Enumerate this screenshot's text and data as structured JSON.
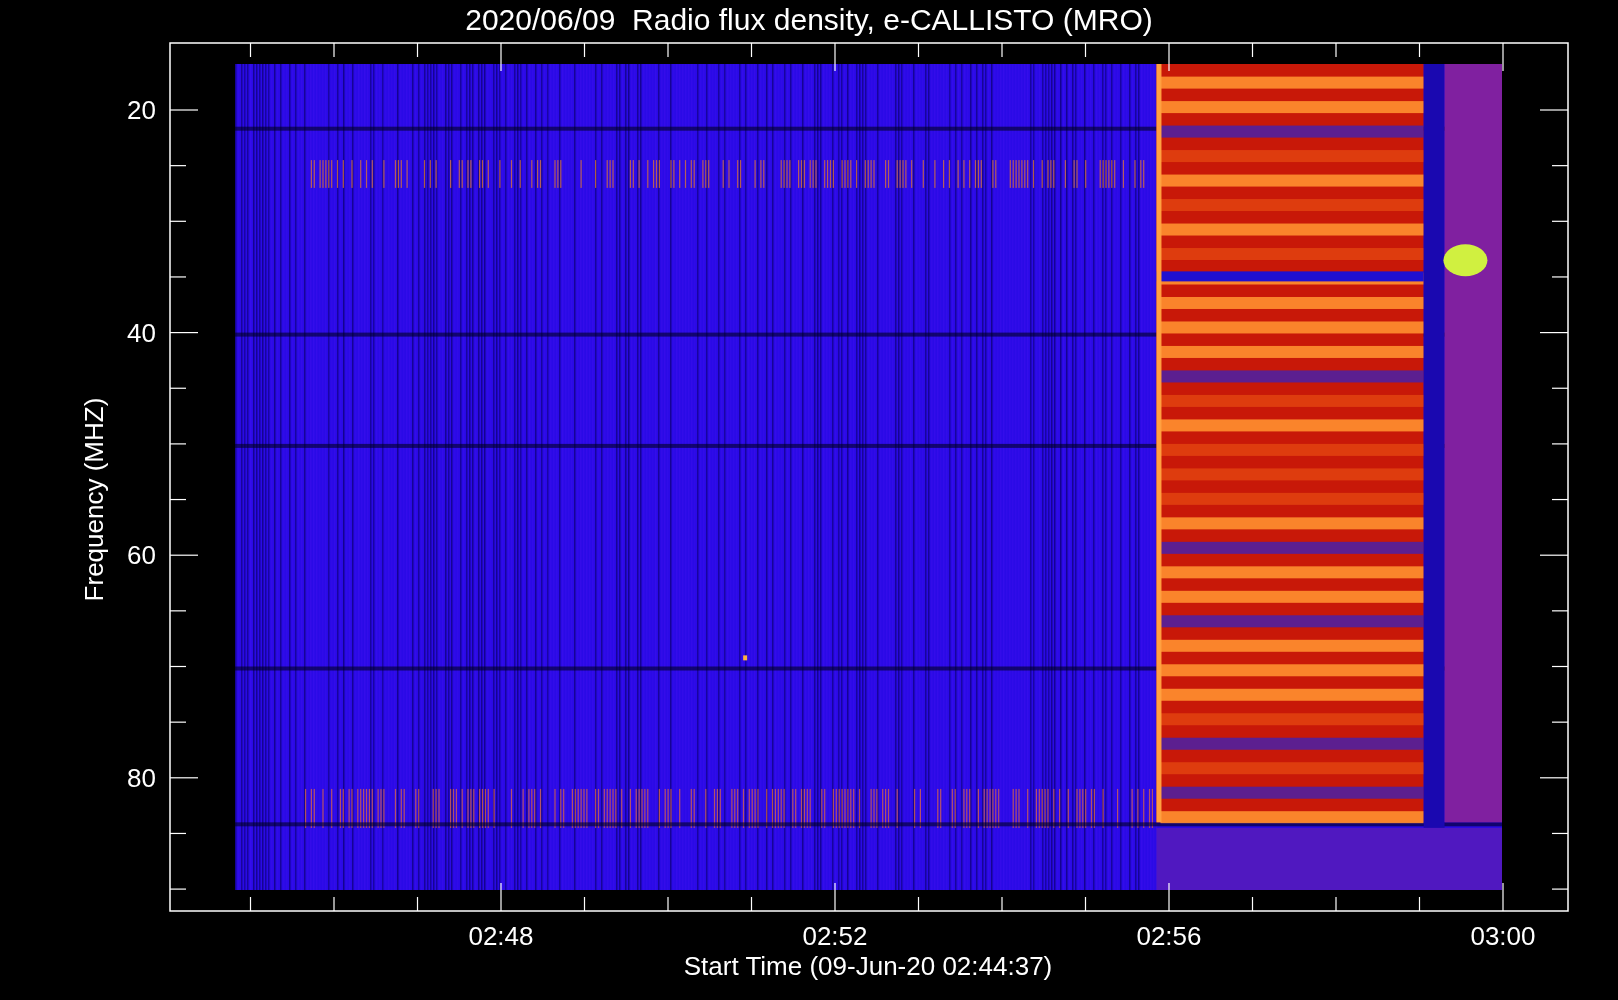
{
  "title": "2020/06/09  Radio flux density, e-CALLISTO (MRO)",
  "y_axis": {
    "label": "Frequency (MHZ)",
    "ticks": [
      "20",
      "40",
      "60",
      "80"
    ]
  },
  "x_axis": {
    "label": "Start Time (09-Jun-20 02:44:37)",
    "ticks": [
      "02:48",
      "02:52",
      "02:56",
      "03:00"
    ]
  }
}
